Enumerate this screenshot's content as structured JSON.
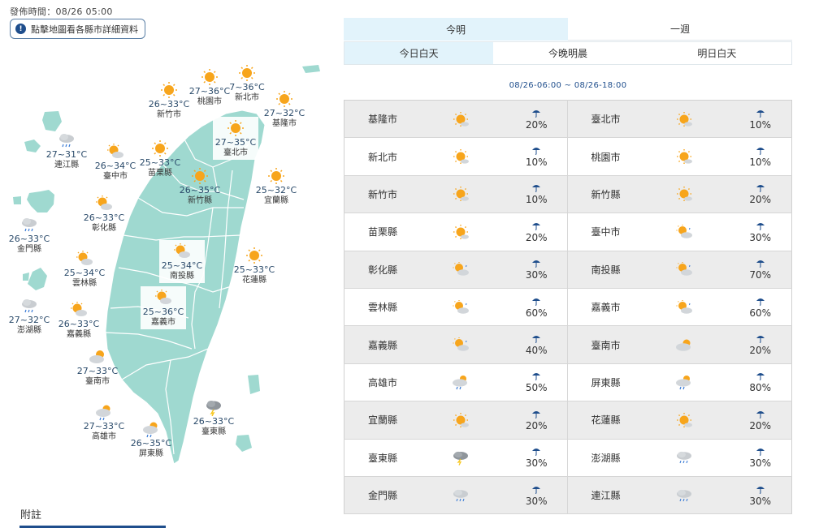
{
  "header": {
    "publish_time": "發佈時間：08/26 05:00",
    "map_hint": "點擊地圖看各縣市詳細資料"
  },
  "colors": {
    "map_fill": "#9fd9d0",
    "map_border": "#ffffff",
    "accent": "#1f4e8c",
    "tab_active": "#e2f3fb"
  },
  "map_markers": [
    {
      "name": "新竹市",
      "temp": "26~33°C",
      "icon": "sunny-icon"
    },
    {
      "name": "桃園市",
      "temp": "27~36°C",
      "icon": "sunny-icon"
    },
    {
      "name": "新北市",
      "temp": "7~36°C",
      "icon": "sunny-icon"
    },
    {
      "name": "基隆市",
      "temp": "27~32°C",
      "icon": "sunny-icon"
    },
    {
      "name": "臺北市",
      "temp": "27~35°C",
      "icon": "sunny-icon"
    },
    {
      "name": "連江縣",
      "temp": "27~31°C",
      "icon": "cloudy-rain-icon"
    },
    {
      "name": "臺中市",
      "temp": "26~34°C",
      "icon": "sunny-cloudy-icon"
    },
    {
      "name": "苗栗縣",
      "temp": "25~33°C",
      "icon": "sunny-icon"
    },
    {
      "name": "新竹縣",
      "temp": "26~35°C",
      "icon": "sunny-icon"
    },
    {
      "name": "宜蘭縣",
      "temp": "25~32°C",
      "icon": "sunny-icon"
    },
    {
      "name": "彰化縣",
      "temp": "26~33°C",
      "icon": "sunny-cloudy-icon"
    },
    {
      "name": "金門縣",
      "temp": "26~33°C",
      "icon": "cloudy-rain-icon"
    },
    {
      "name": "南投縣",
      "temp": "25~34°C",
      "icon": "sunny-cloudy-icon"
    },
    {
      "name": "花蓮縣",
      "temp": "25~33°C",
      "icon": "sunny-icon"
    },
    {
      "name": "雲林縣",
      "temp": "25~34°C",
      "icon": "sunny-cloudy-icon"
    },
    {
      "name": "澎湖縣",
      "temp": "27~32°C",
      "icon": "cloudy-rain-icon"
    },
    {
      "name": "嘉義市",
      "temp": "25~36°C",
      "icon": "sunny-cloudy-icon"
    },
    {
      "name": "嘉義縣",
      "temp": "26~33°C",
      "icon": "sunny-cloudy-icon"
    },
    {
      "name": "臺南市",
      "temp": "27~33°C",
      "icon": "cloudy-sun-icon"
    },
    {
      "name": "高雄市",
      "temp": "27~33°C",
      "icon": "cloudy-sun-rain-icon"
    },
    {
      "name": "屏東縣",
      "temp": "26~35°C",
      "icon": "cloudy-sun-rain-icon"
    },
    {
      "name": "臺東縣",
      "temp": "26~33°C",
      "icon": "thunder-cloud-icon"
    }
  ],
  "tabs": {
    "main": [
      "今明",
      "一週"
    ],
    "sub": [
      "今日白天",
      "今晚明晨",
      "明日白天"
    ]
  },
  "period": "08/26-06:00 ~ 08/26-18:00",
  "forecast_rows": [
    {
      "left": {
        "city": "基隆市",
        "icon": "sunny-icon",
        "rain": "20%"
      },
      "right": {
        "city": "臺北市",
        "icon": "sunny-icon",
        "rain": "10%"
      }
    },
    {
      "left": {
        "city": "新北市",
        "icon": "sunny-icon",
        "rain": "10%"
      },
      "right": {
        "city": "桃園市",
        "icon": "sunny-icon",
        "rain": "10%"
      }
    },
    {
      "left": {
        "city": "新竹市",
        "icon": "sunny-icon",
        "rain": "10%"
      },
      "right": {
        "city": "新竹縣",
        "icon": "sunny-icon",
        "rain": "20%"
      }
    },
    {
      "left": {
        "city": "苗栗縣",
        "icon": "sunny-icon",
        "rain": "20%"
      },
      "right": {
        "city": "臺中市",
        "icon": "sunny-cloudy-icon",
        "rain": "30%"
      }
    },
    {
      "left": {
        "city": "彰化縣",
        "icon": "sunny-cloudy-icon",
        "rain": "30%"
      },
      "right": {
        "city": "南投縣",
        "icon": "sunny-cloudy-icon",
        "rain": "70%"
      }
    },
    {
      "left": {
        "city": "雲林縣",
        "icon": "sunny-cloudy-icon",
        "rain": "60%"
      },
      "right": {
        "city": "嘉義市",
        "icon": "sunny-cloudy-icon",
        "rain": "60%"
      }
    },
    {
      "left": {
        "city": "嘉義縣",
        "icon": "sunny-cloudy-icon",
        "rain": "40%"
      },
      "right": {
        "city": "臺南市",
        "icon": "cloudy-sun-icon",
        "rain": "20%"
      }
    },
    {
      "left": {
        "city": "高雄市",
        "icon": "cloudy-sun-rain-icon",
        "rain": "50%"
      },
      "right": {
        "city": "屏東縣",
        "icon": "cloudy-sun-rain-icon",
        "rain": "80%"
      }
    },
    {
      "left": {
        "city": "宜蘭縣",
        "icon": "sunny-icon",
        "rain": "20%"
      },
      "right": {
        "city": "花蓮縣",
        "icon": "sunny-icon",
        "rain": "20%"
      }
    },
    {
      "left": {
        "city": "臺東縣",
        "icon": "thunder-cloud-icon",
        "rain": "30%"
      },
      "right": {
        "city": "澎湖縣",
        "icon": "cloudy-rain-icon",
        "rain": "30%"
      }
    },
    {
      "left": {
        "city": "金門縣",
        "icon": "cloudy-rain-icon",
        "rain": "30%"
      },
      "right": {
        "city": "連江縣",
        "icon": "cloudy-rain-icon",
        "rain": "30%"
      }
    }
  ],
  "notes_heading": "附註"
}
